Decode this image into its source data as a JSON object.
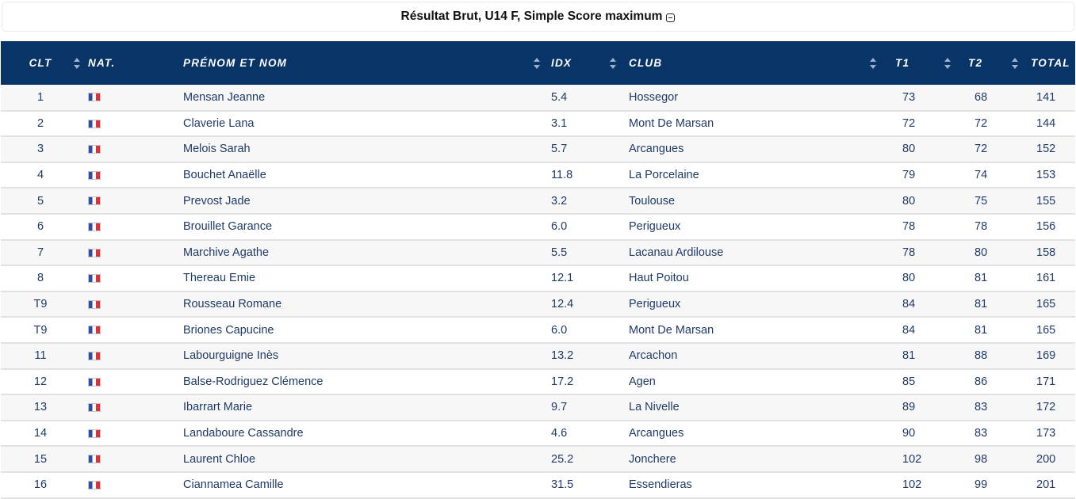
{
  "title": "Résultat Brut, U14 F, Simple Score maximum",
  "columns": {
    "clt": "CLT",
    "nat": "NAT.",
    "name": "PRÉNOM ET NOM",
    "idx": "IDX",
    "club": "CLUB",
    "t1": "T1",
    "t2": "T2",
    "total": "TOTAL"
  },
  "flag_icon": "france-flag-icon",
  "flag_colors": [
    "#2b4fa8",
    "#ffffff",
    "#e0313b"
  ],
  "rows": [
    {
      "clt": "1",
      "name": "Mensan Jeanne",
      "idx": "5.4",
      "club": "Hossegor",
      "t1": "73",
      "t2": "68",
      "total": "141"
    },
    {
      "clt": "2",
      "name": "Claverie Lana",
      "idx": "3.1",
      "club": "Mont De Marsan",
      "t1": "72",
      "t2": "72",
      "total": "144"
    },
    {
      "clt": "3",
      "name": "Melois Sarah",
      "idx": "5.7",
      "club": "Arcangues",
      "t1": "80",
      "t2": "72",
      "total": "152"
    },
    {
      "clt": "4",
      "name": "Bouchet Anaëlle",
      "idx": "11.8",
      "club": "La Porcelaine",
      "t1": "79",
      "t2": "74",
      "total": "153"
    },
    {
      "clt": "5",
      "name": "Prevost Jade",
      "idx": "3.2",
      "club": "Toulouse",
      "t1": "80",
      "t2": "75",
      "total": "155"
    },
    {
      "clt": "6",
      "name": "Brouillet Garance",
      "idx": "6.0",
      "club": "Perigueux",
      "t1": "78",
      "t2": "78",
      "total": "156"
    },
    {
      "clt": "7",
      "name": "Marchive Agathe",
      "idx": "5.5",
      "club": "Lacanau Ardilouse",
      "t1": "78",
      "t2": "80",
      "total": "158"
    },
    {
      "clt": "8",
      "name": "Thereau Emie",
      "idx": "12.1",
      "club": "Haut Poitou",
      "t1": "80",
      "t2": "81",
      "total": "161"
    },
    {
      "clt": "T9",
      "name": "Rousseau Romane",
      "idx": "12.4",
      "club": "Perigueux",
      "t1": "84",
      "t2": "81",
      "total": "165"
    },
    {
      "clt": "T9",
      "name": "Briones Capucine",
      "idx": "6.0",
      "club": "Mont De Marsan",
      "t1": "84",
      "t2": "81",
      "total": "165"
    },
    {
      "clt": "11",
      "name": "Labourguigne Inès",
      "idx": "13.2",
      "club": "Arcachon",
      "t1": "81",
      "t2": "88",
      "total": "169"
    },
    {
      "clt": "12",
      "name": "Balse-Rodriguez Clémence",
      "idx": "17.2",
      "club": "Agen",
      "t1": "85",
      "t2": "86",
      "total": "171"
    },
    {
      "clt": "13",
      "name": "Ibarrart Marie",
      "idx": "9.7",
      "club": "La Nivelle",
      "t1": "89",
      "t2": "83",
      "total": "172"
    },
    {
      "clt": "14",
      "name": "Landaboure Cassandre",
      "idx": "4.6",
      "club": "Arcangues",
      "t1": "90",
      "t2": "83",
      "total": "173"
    },
    {
      "clt": "15",
      "name": "Laurent Chloe",
      "idx": "25.2",
      "club": "Jonchere",
      "t1": "102",
      "t2": "98",
      "total": "200"
    },
    {
      "clt": "16",
      "name": "Ciannamea Camille",
      "idx": "31.5",
      "club": "Essendieras",
      "t1": "102",
      "t2": "99",
      "total": "201"
    }
  ]
}
